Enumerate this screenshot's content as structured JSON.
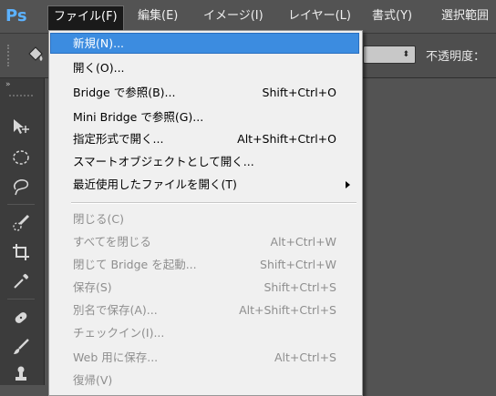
{
  "app": {
    "logo": "Ps"
  },
  "menubar": {
    "items": [
      {
        "label": "ファイル(F)"
      },
      {
        "label": "編集(E)"
      },
      {
        "label": "イメージ(I)"
      },
      {
        "label": "レイヤー(L)"
      },
      {
        "label": "書式(Y)"
      },
      {
        "label": "選択範囲"
      }
    ]
  },
  "options": {
    "select_arrow": "⬍",
    "opacity_label": "不透明度："
  },
  "toolbox": {
    "collapse_glyph": "»",
    "tools": [
      {
        "name": "move-tool-icon"
      },
      {
        "name": "elliptical-marquee-tool-icon"
      },
      {
        "name": "lasso-tool-icon"
      },
      {
        "name": "quick-selection-tool-icon"
      },
      {
        "name": "crop-tool-icon"
      },
      {
        "name": "eyedropper-tool-icon"
      },
      {
        "name": "spot-healing-brush-tool-icon"
      },
      {
        "name": "brush-tool-icon"
      },
      {
        "name": "clone-stamp-tool-icon"
      }
    ]
  },
  "file_menu": {
    "groups": [
      [
        {
          "label": "新規(N)...",
          "shortcut": "",
          "state": "highlighted"
        },
        {
          "label": "開く(O)...",
          "shortcut": "",
          "state": "enabled"
        },
        {
          "label": "Bridge で参照(B)...",
          "shortcut": "Shift+Ctrl+O",
          "state": "enabled"
        },
        {
          "label": "Mini Bridge で参照(G)...",
          "shortcut": "",
          "state": "enabled"
        },
        {
          "label": "指定形式で開く...",
          "shortcut": "Alt+Shift+Ctrl+O",
          "state": "enabled"
        },
        {
          "label": "スマートオブジェクトとして開く...",
          "shortcut": "",
          "state": "enabled"
        },
        {
          "label": "最近使用したファイルを開く(T)",
          "shortcut": "",
          "state": "enabled",
          "submenu": true
        }
      ],
      [
        {
          "label": "閉じる(C)",
          "shortcut": "",
          "state": "disabled"
        },
        {
          "label": "すべてを閉じる",
          "shortcut": "Alt+Ctrl+W",
          "state": "disabled"
        },
        {
          "label": "閉じて Bridge を起動...",
          "shortcut": "Shift+Ctrl+W",
          "state": "disabled"
        },
        {
          "label": "保存(S)",
          "shortcut": "Shift+Ctrl+S",
          "state": "disabled"
        },
        {
          "label": "別名で保存(A)...",
          "shortcut": "Alt+Shift+Ctrl+S",
          "state": "disabled"
        },
        {
          "label": "チェックイン(I)...",
          "shortcut": "",
          "state": "disabled"
        },
        {
          "label": "Web 用に保存...",
          "shortcut": "Alt+Ctrl+S",
          "state": "disabled"
        },
        {
          "label": "復帰(V)",
          "shortcut": "",
          "state": "disabled"
        }
      ]
    ]
  }
}
